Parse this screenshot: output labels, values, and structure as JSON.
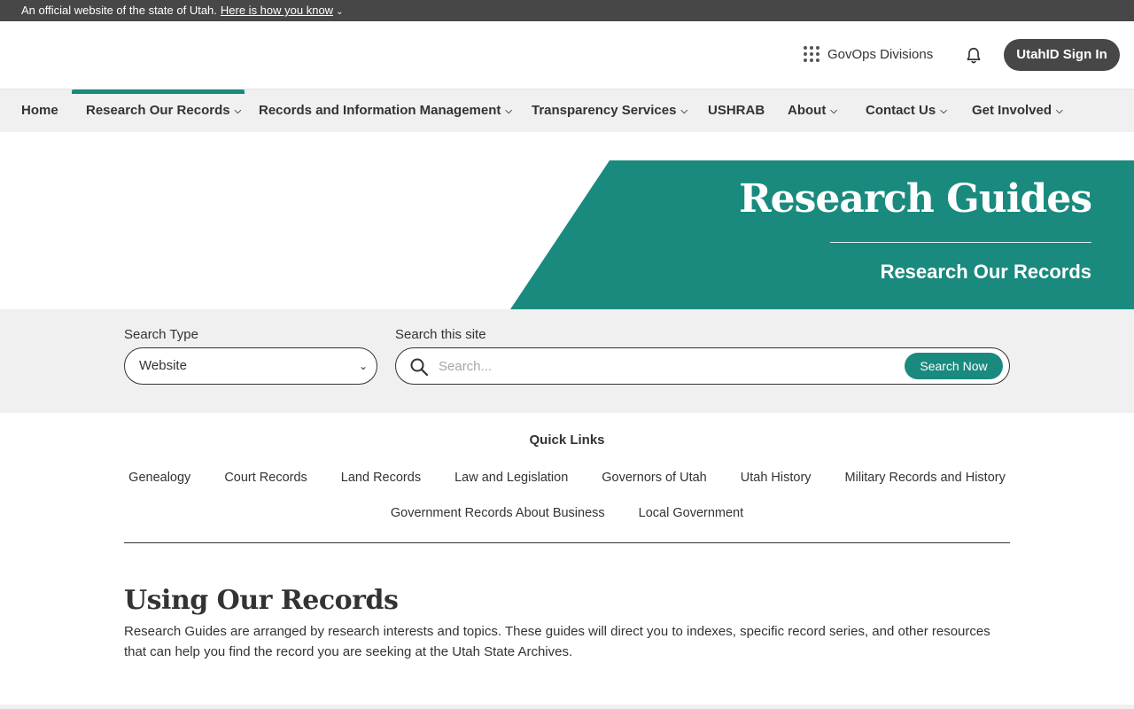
{
  "official_banner": {
    "text": "An official website of the state of Utah.",
    "link": "Here is how you know"
  },
  "header": {
    "govops_label": "GovOps Divisions",
    "signin_label": "UtahID Sign In"
  },
  "nav": {
    "items": [
      {
        "label": "Home",
        "has_dropdown": false
      },
      {
        "label": "Research Our Records",
        "has_dropdown": true,
        "active": true
      },
      {
        "label": "Records and Information Management",
        "has_dropdown": true
      },
      {
        "label": "Transparency Services",
        "has_dropdown": true
      },
      {
        "label": "USHRAB",
        "has_dropdown": false
      },
      {
        "label": "About",
        "has_dropdown": true
      },
      {
        "label": "Contact Us",
        "has_dropdown": true
      },
      {
        "label": "Get Involved",
        "has_dropdown": true
      }
    ]
  },
  "hero": {
    "title": "Research Guides",
    "subtitle": "Research Our Records",
    "accent_color": "#1a8a7e"
  },
  "search": {
    "type_label": "Search Type",
    "type_value": "Website",
    "site_label": "Search this site",
    "placeholder": "Search...",
    "button_label": "Search Now"
  },
  "quick_links": {
    "title": "Quick Links",
    "row1": [
      "Genealogy",
      "Court Records",
      "Land Records",
      "Law and Legislation",
      "Governors of Utah",
      "Utah History",
      "Military Records and History"
    ],
    "row2": [
      "Government Records About Business",
      "Local Government"
    ]
  },
  "content": {
    "title": "Using Our Records",
    "body": "Research Guides are arranged by research interests and topics. These guides will direct you to indexes, specific record series, and other resources that can help you find the record you are seeking at the Utah State Archives."
  }
}
